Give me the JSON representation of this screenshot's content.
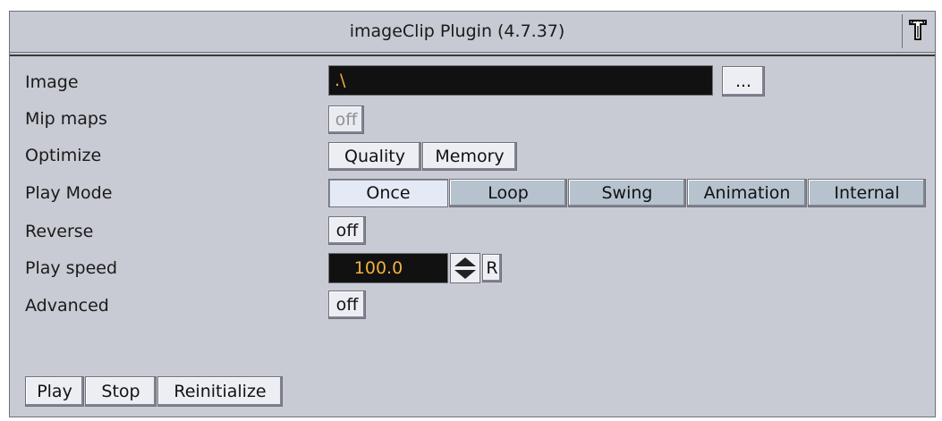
{
  "window": {
    "title": "imageClip Plugin (4.7.37)",
    "corner_icon": "plugin-logo-icon"
  },
  "rows": {
    "image": {
      "label": "Image",
      "value": ".\\",
      "browse_label": "..."
    },
    "mip_maps": {
      "label": "Mip maps",
      "value": "off"
    },
    "optimize": {
      "label": "Optimize",
      "options": [
        "Quality",
        "Memory"
      ],
      "selected": "Quality"
    },
    "play_mode": {
      "label": "Play Mode",
      "options": [
        "Once",
        "Loop",
        "Swing",
        "Animation",
        "Internal"
      ],
      "selected": "Once"
    },
    "reverse": {
      "label": "Reverse",
      "value": "off"
    },
    "play_speed": {
      "label": "Play speed",
      "value": "100.0",
      "reset_label": "R"
    },
    "advanced": {
      "label": "Advanced",
      "value": "off"
    }
  },
  "actions": {
    "play": "Play",
    "stop": "Stop",
    "reinitialize": "Reinitialize"
  },
  "colors": {
    "panel_bg": "#c8cbd3",
    "field_bg": "#111111",
    "field_text": "#f0b23a",
    "segment_bg": "#b6c3cf",
    "segment_active": "#e4e9f6"
  }
}
